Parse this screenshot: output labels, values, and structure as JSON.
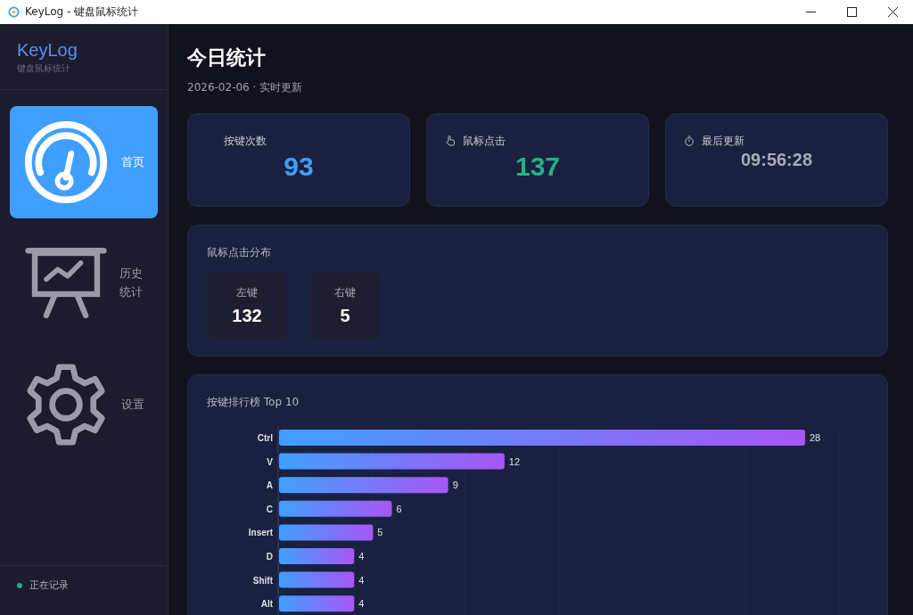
{
  "window": {
    "title": "KeyLog - 键盘鼠标统计"
  },
  "sidebar": {
    "app_name": "KeyLog",
    "app_subtitle": "键盘鼠标统计",
    "items": [
      {
        "label": "首页",
        "kind": "gauge",
        "selected": true
      },
      {
        "label": "历史统计",
        "kind": "chart",
        "selected": false
      },
      {
        "label": "设置",
        "kind": "gear",
        "selected": false
      }
    ],
    "status": {
      "label": "正在记录",
      "recording": true
    }
  },
  "page": {
    "title": "今日统计",
    "subtitle": "2026-02-06 · 实时更新"
  },
  "stat_cards": [
    {
      "kind": "count",
      "label": "按键次数",
      "value": "93",
      "color": "#409eff"
    },
    {
      "kind": "clicks",
      "label": "鼠标点击",
      "value": "137",
      "color": "#20b483"
    },
    {
      "kind": "time",
      "label": "最后更新",
      "value": "09:56:28",
      "color": "#a8abb8"
    }
  ],
  "click_distribution": {
    "title": "鼠标点击分布",
    "items": [
      {
        "label": "左键",
        "value": "132"
      },
      {
        "label": "右键",
        "value": "5"
      }
    ]
  },
  "key_ranking": {
    "title": "按键排行榜 Top 10",
    "chart_data": {
      "type": "bar",
      "orientation": "horizontal",
      "categories": [
        "Ctrl",
        "V",
        "A",
        "C",
        "Insert",
        "D",
        "Shift",
        "Alt"
      ],
      "values": [
        28,
        12,
        9,
        6,
        5,
        4,
        4,
        4
      ],
      "data_labels": true
    }
  }
}
